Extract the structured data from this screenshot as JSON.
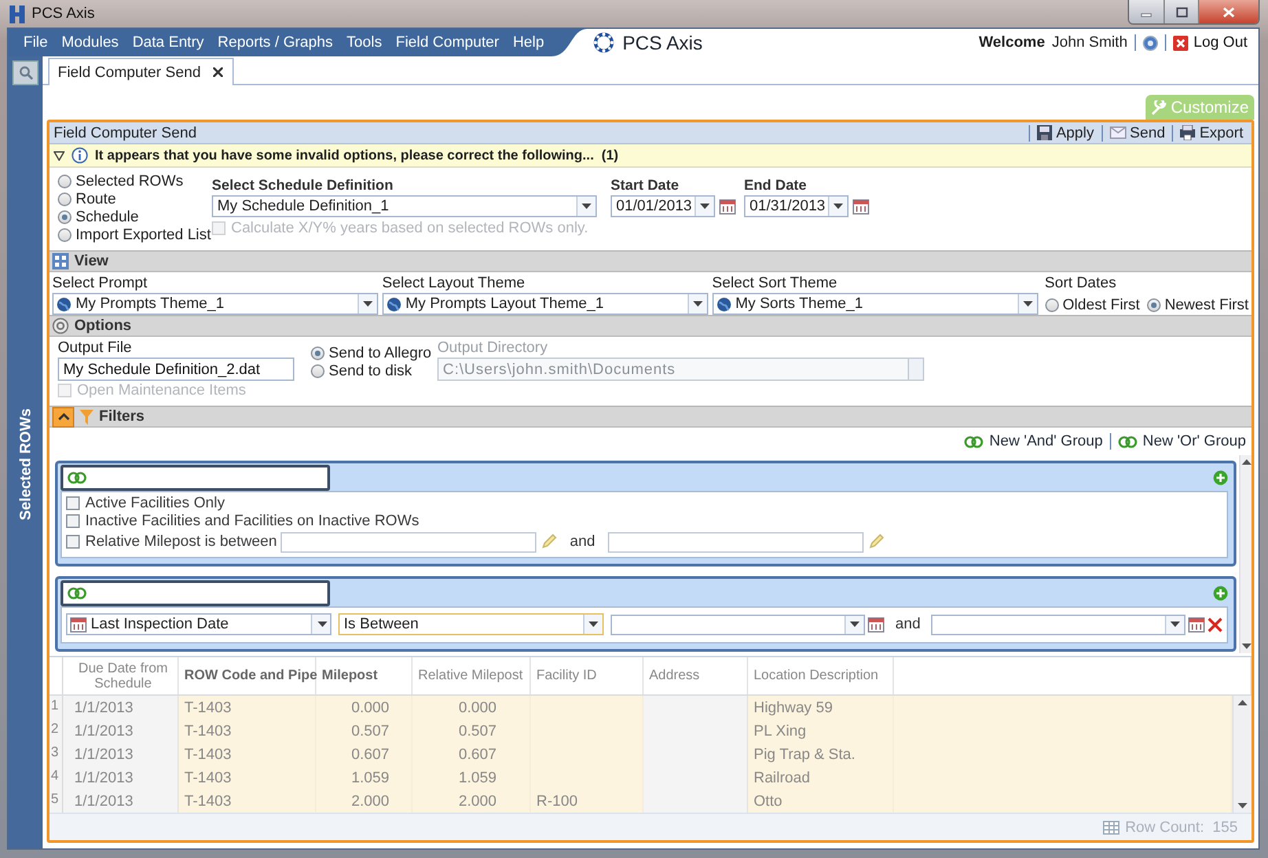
{
  "window": {
    "title": "PCS Axis"
  },
  "menu": [
    "File",
    "Modules",
    "Data Entry",
    "Reports / Graphs",
    "Tools",
    "Field Computer",
    "Help"
  ],
  "brand": "PCS Axis",
  "user_bar": {
    "welcome": "Welcome",
    "user_name": "John Smith",
    "logout": "Log Out"
  },
  "sidebar": {
    "label": "Selected ROWs"
  },
  "tabs": [
    {
      "label": "Field Computer Send",
      "selected": true
    }
  ],
  "customize": "Customize",
  "panel": {
    "title": "Field Computer Send",
    "actions": [
      "Apply",
      "Send",
      "Export"
    ]
  },
  "warning": {
    "text": "It appears that you have some invalid options, please correct the following...  (1)"
  },
  "source_options": [
    {
      "label": "Selected ROWs",
      "selected": false
    },
    {
      "label": "Route",
      "selected": false
    },
    {
      "label": "Schedule",
      "selected": true
    },
    {
      "label": "Import Exported List",
      "selected": false
    }
  ],
  "schedule_definition": {
    "label": "Select Schedule Definition",
    "value": "My Schedule Definition_1"
  },
  "calc_option": {
    "label": "Calculate X/Y% years based on selected ROWs only.",
    "checked": false,
    "disabled": true
  },
  "start_date": {
    "label": "Start Date",
    "value": "01/01/2013"
  },
  "end_date": {
    "label": "End Date",
    "value": "01/31/2013"
  },
  "view": {
    "title": "View",
    "selects": [
      {
        "label": "Select Prompt",
        "value": "My Prompts Theme_1"
      },
      {
        "label": "Select Layout Theme",
        "value": "My Prompts Layout Theme_1"
      },
      {
        "label": "Select Sort Theme",
        "value": "My Sorts Theme_1"
      }
    ],
    "sort_dates": {
      "label": "Sort Dates",
      "options": [
        {
          "label": "Oldest First",
          "selected": false
        },
        {
          "label": "Newest First",
          "selected": true
        }
      ]
    }
  },
  "options": {
    "title": "Options",
    "output_file": {
      "label": "Output File",
      "value": "My Schedule Definition_2.dat"
    },
    "send_to": [
      {
        "label": "Send to Allegro",
        "selected": true
      },
      {
        "label": "Send to disk",
        "selected": false
      }
    ],
    "output_directory": {
      "label": "Output Directory",
      "value": "C:\\Users\\john.smith\\Documents",
      "disabled": true
    },
    "open_maintenance": {
      "label": "Open Maintenance Items",
      "checked": false,
      "disabled": true
    }
  },
  "filters": {
    "title": "Filters",
    "actions": [
      "New 'And' Group",
      "New 'Or' Group"
    ],
    "groups": [
      {
        "conditions": [
          {
            "kind": "checkbox",
            "label": "Active Facilities Only",
            "checked": false
          },
          {
            "kind": "checkbox",
            "label": "Inactive Facilities and Facilities on Inactive ROWs",
            "checked": false
          },
          {
            "kind": "range",
            "label": "Relative Milepost is between",
            "checked": false,
            "joiner": "and"
          }
        ]
      },
      {
        "conditions": [
          {
            "kind": "date_range",
            "field": "Last Inspection Date",
            "operator": "Is Between",
            "joiner": "and"
          }
        ]
      }
    ]
  },
  "table": {
    "columns": [
      "Due Date from Schedule",
      "ROW Code and Pipe",
      "Milepost",
      "Relative Milepost",
      "Facility ID",
      "Address",
      "Location Description"
    ],
    "rows": [
      {
        "number": "1",
        "due_date": "1/1/2013",
        "row_code": "T-1403",
        "milepost": "0.000",
        "relative_milepost": "0.000",
        "location": "Highway 59"
      },
      {
        "number": "2",
        "due_date": "1/1/2013",
        "row_code": "T-1403",
        "milepost": "0.507",
        "relative_milepost": "0.507",
        "location": "PL Xing"
      },
      {
        "number": "3",
        "due_date": "1/1/2013",
        "row_code": "T-1403",
        "milepost": "0.607",
        "relative_milepost": "0.607",
        "location": "Pig Trap & Sta."
      },
      {
        "number": "4",
        "due_date": "1/1/2013",
        "row_code": "T-1403",
        "milepost": "1.059",
        "relative_milepost": "1.059",
        "location": "Railroad"
      },
      {
        "number": "5",
        "due_date": "1/1/2013",
        "row_code": "T-1403",
        "milepost": "2.000",
        "relative_milepost": "2.000",
        "facility_id": "R-100",
        "location": "Otto"
      }
    ],
    "row_count": "Row Count:  155"
  }
}
